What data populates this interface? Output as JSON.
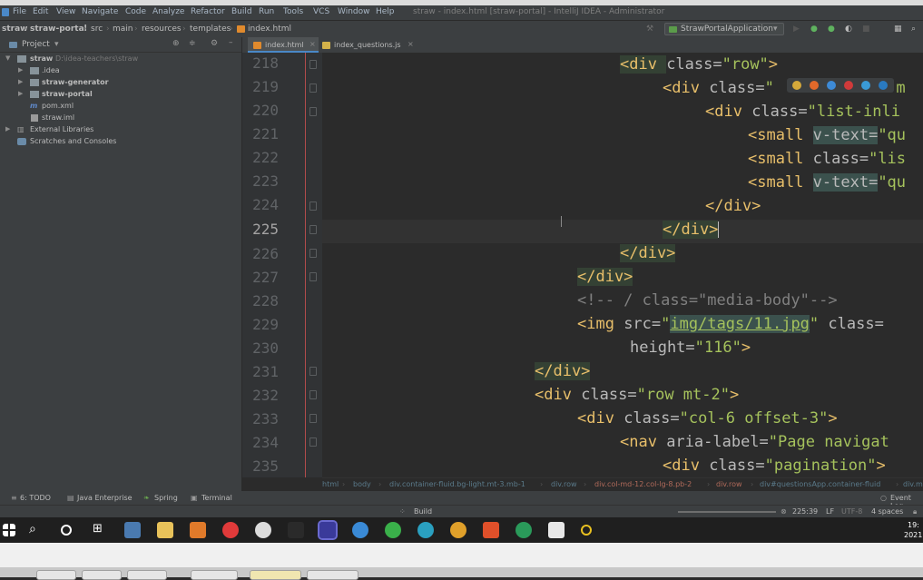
{
  "menu": {
    "items": [
      "File",
      "Edit",
      "View",
      "Navigate",
      "Code",
      "Analyze",
      "Refactor",
      "Build",
      "Run",
      "Tools",
      "VCS",
      "Window",
      "Help"
    ],
    "title": "straw - index.html [straw-portal] - IntelliJ IDEA - Administrator"
  },
  "breadcrumb": [
    "straw",
    "straw-portal",
    "src",
    "main",
    "resources",
    "templates",
    "index.html"
  ],
  "run_config": "StrawPortalApplication",
  "project": {
    "header": "Project",
    "tree": [
      {
        "label": "straw",
        "path": "D:\\idea-teachers\\straw",
        "bold": true
      },
      {
        "label": ".idea",
        "bold": false
      },
      {
        "label": "straw-generator",
        "bold": true
      },
      {
        "label": "straw-portal",
        "bold": true
      },
      {
        "label": "pom.xml",
        "bold": false
      },
      {
        "label": "straw.iml",
        "bold": false
      },
      {
        "label": "External Libraries",
        "bold": false
      },
      {
        "label": "Scratches and Consoles",
        "bold": false
      }
    ]
  },
  "tabs": [
    {
      "label": "index.html",
      "active": true
    },
    {
      "label": "index_questions.js",
      "active": false
    }
  ],
  "line_numbers": [
    "218",
    "219",
    "220",
    "221",
    "222",
    "223",
    "224",
    "225",
    "226",
    "227",
    "228",
    "229",
    "230",
    "231",
    "232",
    "233",
    "234",
    "235"
  ],
  "current_line": "225",
  "code": {
    "l218": {
      "open": "<div ",
      "attr": "class=",
      "val": "\"row\"",
      "close": ">"
    },
    "l219": {
      "open": "<div ",
      "attr": "class=",
      "val": "\"",
      "tail": "t-m"
    },
    "l220": {
      "open": "<div ",
      "attr": "class=",
      "val": "\"list-inli"
    },
    "l221": {
      "open": "<small ",
      "attr": "v-text=",
      "val": "\"qu"
    },
    "l222": {
      "open": "<small ",
      "attr": "class=",
      "val": "\"lis"
    },
    "l223": {
      "open": "<small ",
      "attr": "v-text=",
      "val": "\"qu"
    },
    "l224": {
      "text": "</div>"
    },
    "l225": {
      "text": "</div>"
    },
    "l226": {
      "text": "</div>"
    },
    "l227": {
      "text": "</div>"
    },
    "l228": {
      "text": "<!-- / class=\"media-body\"-->"
    },
    "l229": {
      "open": "<img ",
      "attr": "src=",
      "q1": "\"",
      "val": "img/tags/11.jpg",
      "q2": "\"",
      "rest": " class="
    },
    "l230": {
      "attr": "height=",
      "val": "\"116\"",
      "close": ">"
    },
    "l231": {
      "text": "</div>"
    },
    "l232": {
      "open": "<div ",
      "attr": "class=",
      "val": "\"row mt-2\"",
      "close": ">"
    },
    "l233": {
      "open": "<div ",
      "attr": "class=",
      "val": "\"col-6 offset-3\"",
      "close": ">"
    },
    "l234": {
      "open": "<nav ",
      "attr": "aria-label=",
      "val": "\"Page navigat"
    },
    "l235": {
      "open": "<div ",
      "attr": "class=",
      "val": "\"pagination\"",
      "close": "> "
    }
  },
  "browser_icons": [
    "chrome-icon",
    "firefox-icon",
    "safari-icon",
    "opera-icon",
    "ie-icon",
    "edge-icon"
  ],
  "code_breadcrumb": [
    "html",
    "body",
    "div.container-fluid.bg-light.mt-3.mb-1",
    "div.row",
    "div.col-md-12.col-lg-8.pb-2",
    "div.row",
    "div#questionsApp.container-fluid",
    "div.m"
  ],
  "tool_windows": [
    "6: TODO",
    "Java Enterprise",
    "Spring",
    "Terminal"
  ],
  "event_log": "Event Log",
  "status": {
    "build": "Build",
    "position": "225:39",
    "line_sep": "LF",
    "encoding": "UTF-8",
    "indent": "4 spaces"
  },
  "clock": {
    "time": "19:",
    "date": "2021"
  },
  "colors": {
    "tag": "#e8bf6a",
    "value": "#a5c25c",
    "comment": "#808080",
    "attr": "#bababa",
    "accent": "#4a88c7"
  }
}
